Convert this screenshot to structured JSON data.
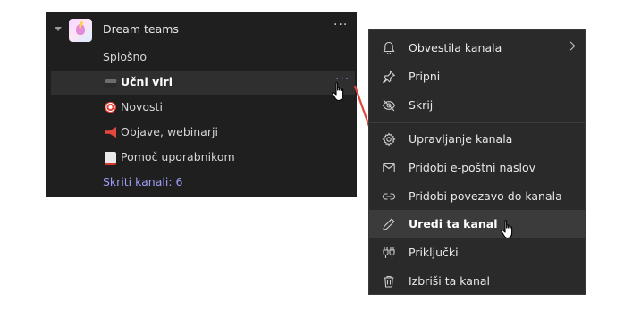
{
  "sidebar": {
    "team_name": "Dream teams",
    "team_more": "···",
    "channels": [
      {
        "label": "Splošno"
      },
      {
        "label": "Učni viri",
        "icon": "graduation-cap-icon"
      },
      {
        "label": "Novosti",
        "icon": "target-icon"
      },
      {
        "label": "Objave, webinarji",
        "icon": "megaphone-icon"
      },
      {
        "label": "Pomoč uporabnikom",
        "icon": "ambulance-icon"
      }
    ],
    "active_more": "···",
    "hidden_channels": "Skriti kanali: 6"
  },
  "menu": {
    "items": [
      {
        "label": "Obvestila kanala",
        "icon": "bell-icon"
      },
      {
        "label": "Pripni",
        "icon": "pin-icon"
      },
      {
        "label": "Skrij",
        "icon": "eye-off-icon"
      },
      {
        "label": "Upravljanje kanala",
        "icon": "gear-icon"
      },
      {
        "label": "Pridobi e-poštni naslov",
        "icon": "envelope-icon"
      },
      {
        "label": "Pridobi povezavo do kanala",
        "icon": "link-icon"
      },
      {
        "label": "Uredi ta kanal",
        "icon": "pencil-icon"
      },
      {
        "label": "Priključki",
        "icon": "connectors-icon"
      },
      {
        "label": "Izbriši ta kanal",
        "icon": "trash-icon"
      }
    ]
  },
  "colors": {
    "panel": "#1f1f1f",
    "menu": "#2a2a2a",
    "accent": "#9e9ef8",
    "arrow": "#e0473d"
  }
}
